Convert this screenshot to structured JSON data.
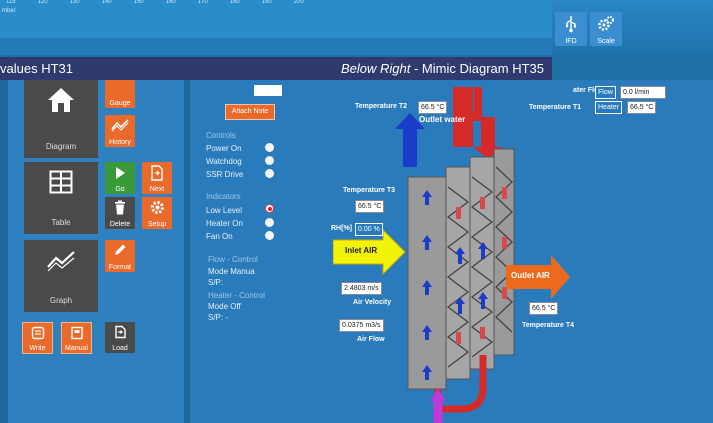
{
  "top": {
    "tick_labels": [
      "115",
      "120",
      "130",
      "140",
      "150",
      "160",
      "170",
      "180",
      "190",
      "200"
    ],
    "tick_sub": "mber",
    "buttons": [
      {
        "label": "IFD",
        "icon": "usb-icon"
      },
      {
        "label": "Scale",
        "icon": "gears-icon"
      }
    ]
  },
  "caption": {
    "left": "values HT31",
    "right_italic": "Below Right",
    "right_rest": " - Mimic Diagram HT35"
  },
  "left_panel": {
    "tiles": [
      {
        "label": "Diagram",
        "icon": "home-icon"
      },
      {
        "label": "Table",
        "icon": "table-icon"
      },
      {
        "label": "Graph",
        "icon": "graph-icon"
      }
    ],
    "small_buttons": {
      "gauge": "Gauge",
      "history": "History",
      "go": "Go",
      "next": "Next",
      "delete": "Delete",
      "setup": "Setup",
      "format": "Format"
    },
    "bottom_buttons": {
      "write": "Write",
      "manual": "Manual",
      "load": "Load"
    }
  },
  "controls": {
    "attach_note": "Attach Note",
    "controls_heading": "Controls",
    "controls": [
      "Power On",
      "Watchdog",
      "SSR Drive"
    ],
    "indicators_heading": "Indicators",
    "indicators": [
      "Low Level",
      "Heater On",
      "Fan On"
    ],
    "flow_control_heading": "Flow - Control",
    "flow_mode": "Mode Manua",
    "flow_sp": "S/P:",
    "heater_control_heading": "Heater - Control",
    "heater_mode": "Mode Off",
    "heater_sp": "S/P:  -"
  },
  "mimic": {
    "water_flow_label": "ater Flow",
    "flow_btn": "Flow",
    "flow_value": "0.0 l/min",
    "temp_t2_label": "Temperature T2",
    "temp_t2_value": "66.5 °C",
    "outlet_water": "Outlet water",
    "temp_t1_label": "Temperature T1",
    "heater_btn": "Heater",
    "temp_t1_value": "66.5 °C",
    "temp_t3_label": "Temperature T3",
    "temp_t3_value": "66.5 °C",
    "rh_label": "RH[%]",
    "rh_value": "0.00 %",
    "inlet_air": "Inlet AIR",
    "air_velocity_value": "2.4803 m/s",
    "air_velocity_label": "Air Velocity",
    "air_flow_value": "0.0375 m3/s",
    "air_flow_label": "Air Flow",
    "outlet_air": "Outlet AIR",
    "temp_t4_value": "66.5 °C",
    "temp_t4_label": "Temperature T4"
  }
}
